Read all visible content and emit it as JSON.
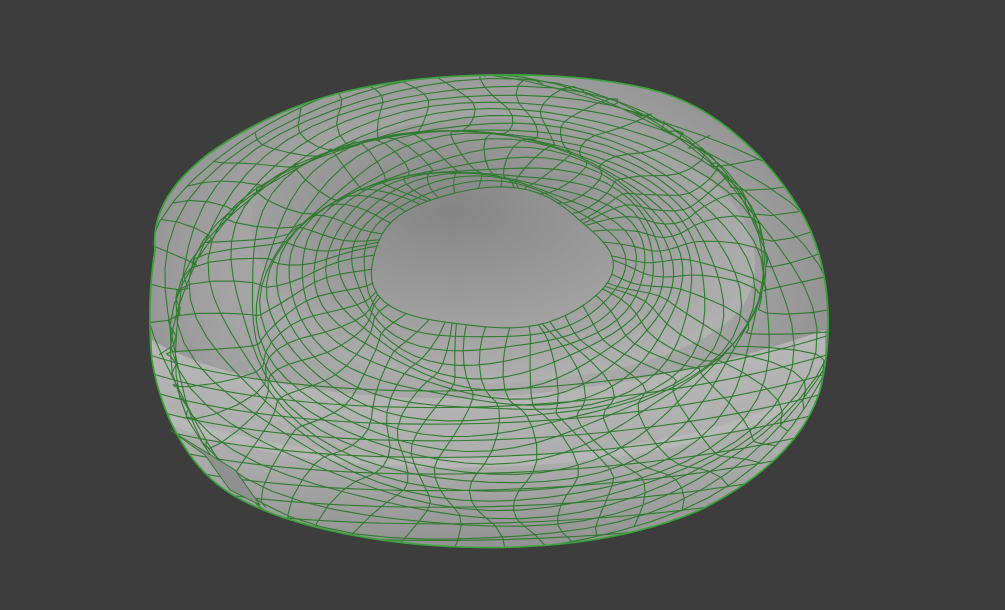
{
  "viewport": {
    "background_color": "#3d3d3d",
    "mesh": {
      "object_shape": "blood-cell-like torus",
      "surface_color": "#a6a6a6",
      "wire_color": "#2f7a2f",
      "outline_color": "#3aa23a",
      "shading_style": "solid-with-wireframe"
    }
  }
}
